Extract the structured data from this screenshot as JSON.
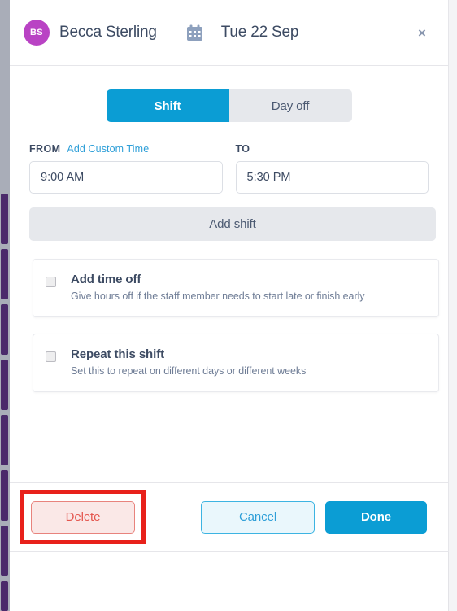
{
  "header": {
    "avatar_initials": "BS",
    "staff_name": "Becca Sterling",
    "calendar_icon": "calendar-icon",
    "date": "Tue 22 Sep",
    "close_icon": "×"
  },
  "segmented": {
    "shift_label": "Shift",
    "dayoff_label": "Day off",
    "selected": "Shift"
  },
  "time_fields": {
    "from_label": "FROM",
    "add_custom_time_label": "Add Custom Time",
    "to_label": "TO",
    "from_value": "9:00 AM",
    "to_value": "5:30 PM",
    "from_placeholder": "9:00 AM",
    "to_placeholder": "5:30 PM"
  },
  "add_shift": {
    "label": "Add shift"
  },
  "options": [
    {
      "title": "Add time off",
      "subtitle": "Give hours off if the staff member needs to start late or finish early",
      "checked": false
    },
    {
      "title": "Repeat this shift",
      "subtitle": "Set this to repeat on different days or different weeks",
      "checked": false
    }
  ],
  "footer": {
    "delete_label": "Delete",
    "cancel_label": "Cancel",
    "done_label": "Done"
  },
  "colors": {
    "accent_blue": "#0b9dd4",
    "link_blue": "#2e9fd8",
    "avatar_purple": "#b943c4",
    "text_dark": "#3d4b63",
    "text_muted": "#6f7d96",
    "delete_red": "#e4564e",
    "annotation_red": "#e8211b",
    "neutral_fill": "#e6e8ec",
    "sidebar_purple": "#4b2a6b"
  }
}
